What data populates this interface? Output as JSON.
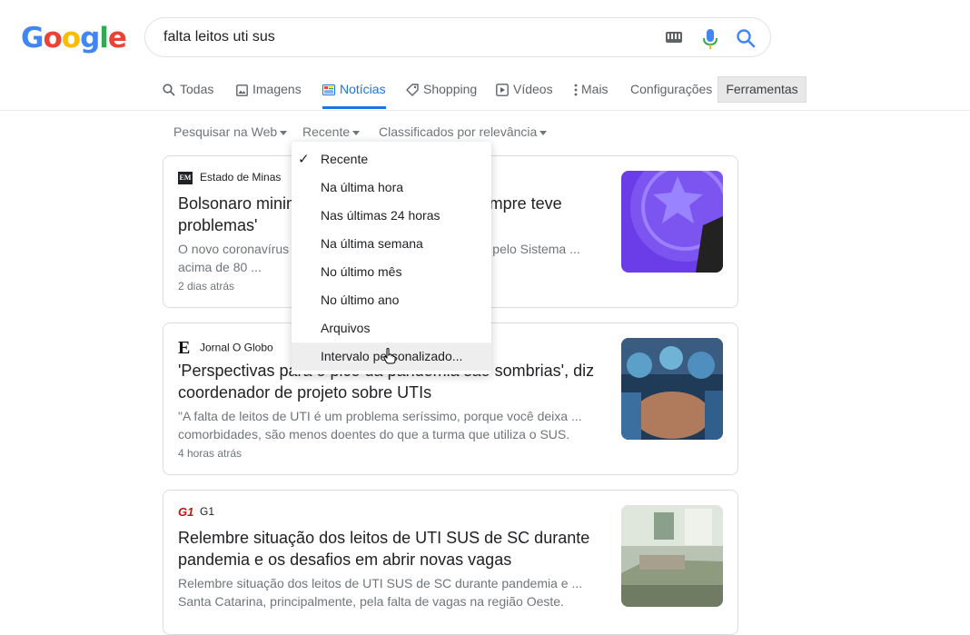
{
  "logo": {
    "letters": [
      "G",
      "o",
      "o",
      "g",
      "l",
      "e"
    ],
    "colors": [
      "#4285f4",
      "#ea4335",
      "#fbbc05",
      "#4285f4",
      "#34a853",
      "#ea4335"
    ]
  },
  "search": {
    "query": "falta leitos uti sus"
  },
  "tabs": [
    {
      "label": "Todas",
      "icon": "search-icon"
    },
    {
      "label": "Imagens",
      "icon": "image-icon"
    },
    {
      "label": "Notícias",
      "icon": "news-icon",
      "active": true
    },
    {
      "label": "Shopping",
      "icon": "tag-icon"
    },
    {
      "label": "Vídeos",
      "icon": "play-icon"
    },
    {
      "label": "Mais",
      "icon": "more-vert-icon"
    },
    {
      "label": "Configurações"
    }
  ],
  "tools_label": "Ferramentas",
  "filters": {
    "web": "Pesquisar na Web",
    "time": "Recente",
    "sort": "Classificados por relevância"
  },
  "menu": {
    "items": [
      "Recente",
      "Na última hora",
      "Nas últimas 24 horas",
      "Na última semana",
      "No último mês",
      "No último ano",
      "Arquivos",
      "Intervalo personalizado..."
    ],
    "selected": "Recente",
    "hovered": "Intervalo personalizado..."
  },
  "results": [
    {
      "source": "Estado de Minas",
      "logo_text": "EM",
      "headline": "Bolsonaro minimiza falta de leitos: 'SUS sempre teve problemas'",
      "snippet": "O novo coronavírus ... as UTIs para adultos destinadas pelo Sistema ... acima de 80 ...",
      "age": "2 dias atrás"
    },
    {
      "source": "Jornal O Globo",
      "logo_text": "E",
      "headline": "'Perspectivas para o pico da pandemia são sombrias', diz coordenador de projeto sobre UTIs",
      "snippet": "\"A falta de leitos de UTI é um problema seríssimo, porque você deixa ... comorbidades, são menos doentes do que a turma que utiliza o SUS.",
      "age": "4 horas atrás"
    },
    {
      "source": "G1",
      "logo_text": "G1",
      "headline": "Relembre situação dos leitos de UTI SUS de SC durante pandemia e os desafios em abrir novas vagas",
      "snippet": "Relembre situação dos leitos de UTI SUS de SC durante pandemia e ... Santa Catarina, principalmente, pela falta de vagas na região Oeste.",
      "age": ""
    }
  ]
}
